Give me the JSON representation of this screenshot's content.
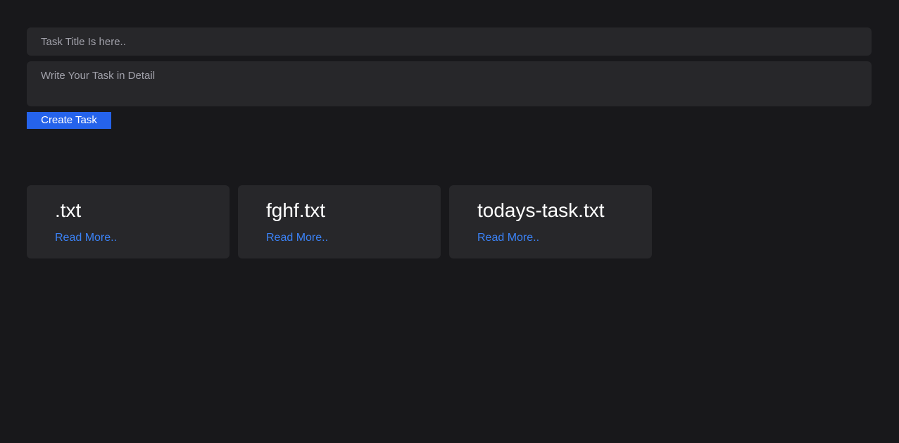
{
  "form": {
    "title_placeholder": "Task Title Is here..",
    "title_value": "",
    "detail_placeholder": "Write Your Task in Detail",
    "detail_value": "",
    "create_label": "Create Task"
  },
  "tasks": [
    {
      "title": ".txt",
      "link_label": "Read More.."
    },
    {
      "title": "fghf.txt",
      "link_label": "Read More.."
    },
    {
      "title": "todays-task.txt",
      "link_label": "Read More.."
    }
  ],
  "colors": {
    "background": "#18181b",
    "surface": "#27272a",
    "accent": "#2563eb",
    "link": "#3b82f6"
  }
}
